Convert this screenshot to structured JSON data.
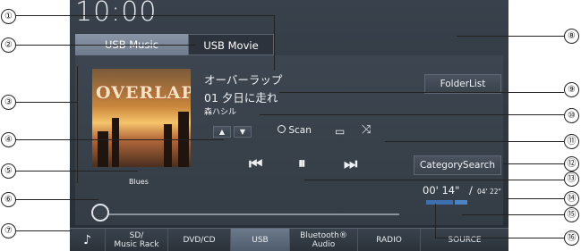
{
  "clock": "10:00",
  "tabs": {
    "music": "USB Music",
    "movie": "USB Movie"
  },
  "track": {
    "album": "オーバーラップ",
    "title": "01 夕日に走れ",
    "artist": "森ハシル",
    "genre": "Blues"
  },
  "album_art_title": "OVERLAP",
  "buttons": {
    "folder_list": "FolderList",
    "category_search": "CategorySearch",
    "scan": "Scan"
  },
  "time": {
    "elapsed": "00' 14\"",
    "separator": "/",
    "total": "04' 22\""
  },
  "bottom_bar": {
    "sd": "SD/\nMusic Rack",
    "dvd": "DVD/CD",
    "usb": "USB",
    "bt": "Bluetooth®\nAudio",
    "radio": "RADIO",
    "source": "SOURCE"
  },
  "callouts": [
    "①",
    "②",
    "③",
    "④",
    "⑤",
    "⑥",
    "⑦",
    "⑧",
    "⑨",
    "⑩",
    "⑪",
    "⑫",
    "⑬",
    "⑭",
    "⑮",
    "⑯"
  ],
  "icons": [
    "up-icon",
    "down-icon",
    "scan-icon",
    "repeat-icon",
    "shuffle-icon",
    "previous-icon",
    "pause-icon",
    "next-icon",
    "menu-icon"
  ]
}
